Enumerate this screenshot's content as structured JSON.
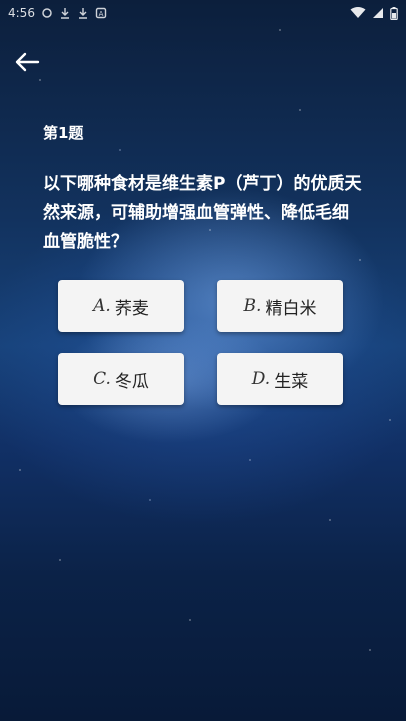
{
  "status_bar": {
    "time": "4:56",
    "icons": [
      "notification-icon",
      "download-icon",
      "download-icon",
      "app-icon",
      "wifi-icon",
      "signal-icon",
      "battery-icon"
    ]
  },
  "question": {
    "number_label": "第1题",
    "text": "以下哪种食材是维生素P（芦丁）的优质天然来源，可辅助增强血管弹性、降低毛细血管脆性？"
  },
  "options": [
    {
      "letter": "A.",
      "label": "荞麦"
    },
    {
      "letter": "B.",
      "label": "精白米"
    },
    {
      "letter": "C.",
      "label": "冬瓜"
    },
    {
      "letter": "D.",
      "label": "生菜"
    }
  ],
  "colors": {
    "background_top": "#0c1f3c",
    "background_mid": "#17427a",
    "option_bg": "#f4f4f4",
    "text": "#ffffff"
  }
}
